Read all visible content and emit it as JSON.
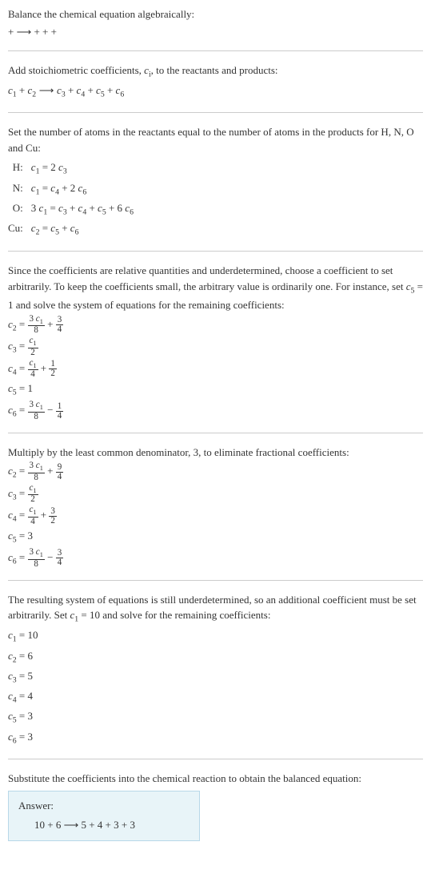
{
  "s1": {
    "title": "Balance the chemical equation algebraically:",
    "eq": " +  ⟶  +  +  + "
  },
  "s2": {
    "title_a": "Add stoichiometric coefficients, ",
    "title_var": "c",
    "title_sub": "i",
    "title_b": ", to the reactants and products:",
    "eq_parts": [
      "c",
      "1",
      " + ",
      "c",
      "2",
      "  ⟶ ",
      "c",
      "3",
      " + ",
      "c",
      "4",
      " + ",
      "c",
      "5",
      " + ",
      "c",
      "6"
    ]
  },
  "s3": {
    "title": "Set the number of atoms in the reactants equal to the number of atoms in the products for H, N, O and Cu:",
    "rows": [
      {
        "el": "H:",
        "eq_html": "<span class=\"italic\">c</span><sub>1</sub> = 2 <span class=\"italic\">c</span><sub>3</sub>"
      },
      {
        "el": "N:",
        "eq_html": "<span class=\"italic\">c</span><sub>1</sub> = <span class=\"italic\">c</span><sub>4</sub> + 2 <span class=\"italic\">c</span><sub>6</sub>"
      },
      {
        "el": "O:",
        "eq_html": "3 <span class=\"italic\">c</span><sub>1</sub> = <span class=\"italic\">c</span><sub>3</sub> + <span class=\"italic\">c</span><sub>4</sub> + <span class=\"italic\">c</span><sub>5</sub> + 6 <span class=\"italic\">c</span><sub>6</sub>"
      },
      {
        "el": "Cu:",
        "eq_html": "<span class=\"italic\">c</span><sub>2</sub> = <span class=\"italic\">c</span><sub>5</sub> + <span class=\"italic\">c</span><sub>6</sub>"
      }
    ]
  },
  "s4": {
    "title_a": "Since the coefficients are relative quantities and underdetermined, choose a coefficient to set arbitrarily. To keep the coefficients small, the arbitrary value is ordinarily one. For instance, set ",
    "title_var_html": "<span class=\"italic\">c</span><sub>5</sub> = 1",
    "title_b": " and solve the system of equations for the remaining coefficients:",
    "rows": [
      "<span class=\"italic\">c</span><sub>2</sub> = <span class=\"frac\"><span class=\"num\">3 <span class=\"italic\">c</span><sub>1</sub></span><span class=\"den\">8</span></span> + <span class=\"frac\"><span class=\"num\">3</span><span class=\"den\">4</span></span>",
      "<span class=\"italic\">c</span><sub>3</sub> = <span class=\"frac\"><span class=\"num\"><span class=\"italic\">c</span><sub>1</sub></span><span class=\"den\">2</span></span>",
      "<span class=\"italic\">c</span><sub>4</sub> = <span class=\"frac\"><span class=\"num\"><span class=\"italic\">c</span><sub>1</sub></span><span class=\"den\">4</span></span> + <span class=\"frac\"><span class=\"num\">1</span><span class=\"den\">2</span></span>",
      "<span class=\"italic\">c</span><sub>5</sub> = 1",
      "<span class=\"italic\">c</span><sub>6</sub> = <span class=\"frac\"><span class=\"num\">3 <span class=\"italic\">c</span><sub>1</sub></span><span class=\"den\">8</span></span> − <span class=\"frac\"><span class=\"num\">1</span><span class=\"den\">4</span></span>"
    ]
  },
  "s5": {
    "title": "Multiply by the least common denominator, 3, to eliminate fractional coefficients:",
    "rows": [
      "<span class=\"italic\">c</span><sub>2</sub> = <span class=\"frac\"><span class=\"num\">3 <span class=\"italic\">c</span><sub>1</sub></span><span class=\"den\">8</span></span> + <span class=\"frac\"><span class=\"num\">9</span><span class=\"den\">4</span></span>",
      "<span class=\"italic\">c</span><sub>3</sub> = <span class=\"frac\"><span class=\"num\"><span class=\"italic\">c</span><sub>1</sub></span><span class=\"den\">2</span></span>",
      "<span class=\"italic\">c</span><sub>4</sub> = <span class=\"frac\"><span class=\"num\"><span class=\"italic\">c</span><sub>1</sub></span><span class=\"den\">4</span></span> + <span class=\"frac\"><span class=\"num\">3</span><span class=\"den\">2</span></span>",
      "<span class=\"italic\">c</span><sub>5</sub> = 3",
      "<span class=\"italic\">c</span><sub>6</sub> = <span class=\"frac\"><span class=\"num\">3 <span class=\"italic\">c</span><sub>1</sub></span><span class=\"den\">8</span></span> − <span class=\"frac\"><span class=\"num\">3</span><span class=\"den\">4</span></span>"
    ]
  },
  "s6": {
    "title_a": "The resulting system of equations is still underdetermined, so an additional coefficient must be set arbitrarily. Set ",
    "title_var_html": "<span class=\"italic\">c</span><sub>1</sub> = 10",
    "title_b": " and solve for the remaining coefficients:",
    "rows": [
      "<span class=\"italic\">c</span><sub>1</sub> = 10",
      "<span class=\"italic\">c</span><sub>2</sub> = 6",
      "<span class=\"italic\">c</span><sub>3</sub> = 5",
      "<span class=\"italic\">c</span><sub>4</sub> = 4",
      "<span class=\"italic\">c</span><sub>5</sub> = 3",
      "<span class=\"italic\">c</span><sub>6</sub> = 3"
    ]
  },
  "s7": {
    "title": "Substitute the coefficients into the chemical reaction to obtain the balanced equation:",
    "answer_label": "Answer:",
    "answer_eq": "10  + 6  ⟶ 5  + 4  + 3  + 3 "
  }
}
